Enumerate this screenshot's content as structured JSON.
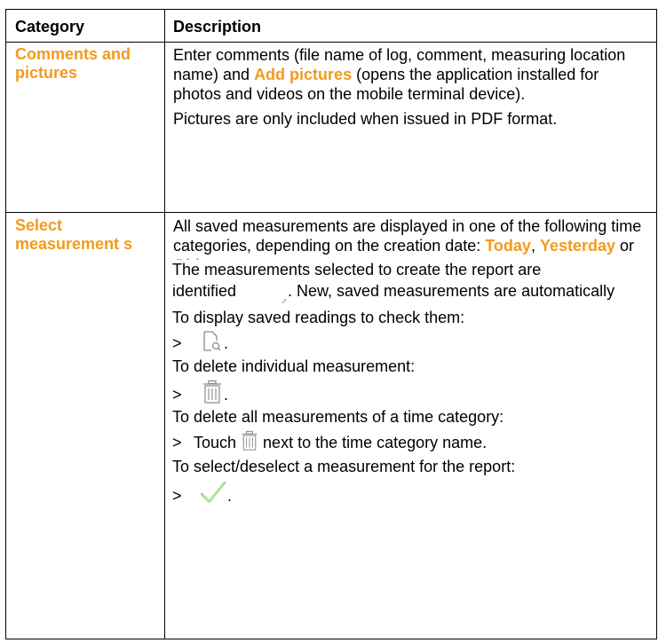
{
  "table": {
    "headers": {
      "category": "Category",
      "description": "Description"
    },
    "rows": [
      {
        "category": "Comments and pictures",
        "para1_a": "Enter comments (file name of log, comment, measuring location name) and ",
        "para1_highlight": "Add pictures",
        "para1_b": " (opens the application installed for photos and videos on the mobile terminal device).",
        "para2": "Pictures are only included when issued in PDF format."
      },
      {
        "category": "Select measurement s",
        "para1_a": "All saved measurements are displayed in one of the following time categories, depending on the creation date: ",
        "today": "Today",
        "sep1": ", ",
        "yesterday": "Yesterday",
        "sep2": " or ",
        "older": "Older",
        "end1": ".",
        "para2_a": "The measurements selected to create the report are identified with ",
        "para2_b": ". New, saved measurements are automatically identified.",
        "para3": "To display saved readings to check them:",
        "step_marker": ">",
        "step_end": ".",
        "para4": "To delete individual measurement:",
        "para5": "To delete all measurements of a time category:",
        "step5_a": "Touch ",
        "step5_b": " next to the time category name.",
        "para6": "To select/deselect a measurement for the report:"
      }
    ]
  },
  "colors": {
    "highlight": "#f39a1e",
    "check": "#6cc24a",
    "icon_gray": "#8a8a8a"
  },
  "icons": [
    "checkmark-icon",
    "document-search-icon",
    "trash-icon"
  ]
}
